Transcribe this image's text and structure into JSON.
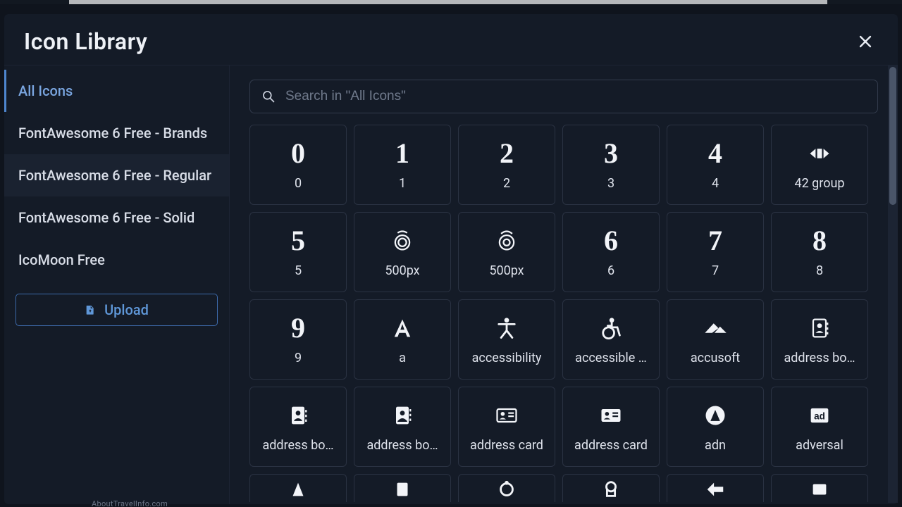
{
  "header": {
    "title": "Icon Library"
  },
  "sidebar": {
    "items": [
      {
        "label": "All Icons",
        "active": true
      },
      {
        "label": "FontAwesome 6 Free - Brands"
      },
      {
        "label": "FontAwesome 6 Free - Regular",
        "hovered": true
      },
      {
        "label": "FontAwesome 6 Free - Solid"
      },
      {
        "label": "IcoMoon Free"
      }
    ],
    "upload_label": "Upload"
  },
  "search": {
    "placeholder": "Search in \"All Icons\"",
    "value": ""
  },
  "icons": [
    {
      "label": "0",
      "glyph_text": "0"
    },
    {
      "label": "1",
      "glyph_text": "1"
    },
    {
      "label": "2",
      "glyph_text": "2"
    },
    {
      "label": "3",
      "glyph_text": "3"
    },
    {
      "label": "4",
      "glyph_text": "4"
    },
    {
      "label": "42 group",
      "glyph_icon": "42group"
    },
    {
      "label": "5",
      "glyph_text": "5"
    },
    {
      "label": "500px",
      "glyph_icon": "500px-a"
    },
    {
      "label": "500px",
      "glyph_icon": "500px-b"
    },
    {
      "label": "6",
      "glyph_text": "6"
    },
    {
      "label": "7",
      "glyph_text": "7"
    },
    {
      "label": "8",
      "glyph_text": "8"
    },
    {
      "label": "9",
      "glyph_text": "9"
    },
    {
      "label": "a",
      "glyph_icon": "letter-a"
    },
    {
      "label": "accessibility",
      "glyph_icon": "accessibility"
    },
    {
      "label": "accessible …",
      "glyph_icon": "accessible-icon"
    },
    {
      "label": "accusoft",
      "glyph_icon": "accusoft"
    },
    {
      "label": "address bo…",
      "glyph_icon": "address-book"
    },
    {
      "label": "address bo…",
      "glyph_icon": "address-book-solid"
    },
    {
      "label": "address bo…",
      "glyph_icon": "address-book-alt"
    },
    {
      "label": "address card",
      "glyph_icon": "address-card"
    },
    {
      "label": "address card",
      "glyph_icon": "address-card-solid"
    },
    {
      "label": "adn",
      "glyph_icon": "adn"
    },
    {
      "label": "adversal",
      "glyph_icon": "adversal"
    }
  ],
  "partial_icons": [
    {
      "glyph_icon": "partial-1"
    },
    {
      "glyph_icon": "partial-2"
    },
    {
      "glyph_icon": "partial-3"
    },
    {
      "glyph_icon": "partial-4"
    },
    {
      "glyph_icon": "partial-5"
    },
    {
      "glyph_icon": "partial-6"
    }
  ],
  "peek_text": "AboutTravelInfo.com"
}
